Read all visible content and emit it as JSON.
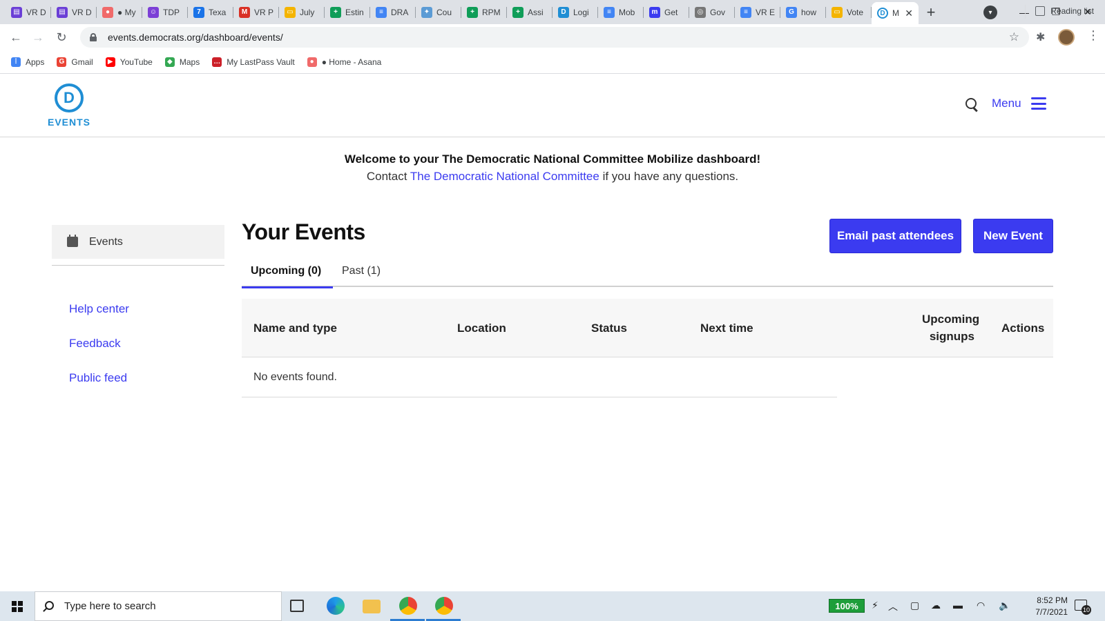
{
  "browser": {
    "tabs": [
      {
        "title": "VR D",
        "icon": "form-icon",
        "color": "#6b3fd6"
      },
      {
        "title": "VR D",
        "icon": "form-icon",
        "color": "#6b3fd6"
      },
      {
        "title": "● My",
        "icon": "asana-icon",
        "color": "#f06a6a"
      },
      {
        "title": "TDP",
        "icon": "people-icon",
        "color": "#7c3fd6"
      },
      {
        "title": "Texa",
        "icon": "calendar-icon",
        "color": "#1a73e8"
      },
      {
        "title": "VR P",
        "icon": "gmail-icon",
        "color": "#d93025"
      },
      {
        "title": "July",
        "icon": "slides-icon",
        "color": "#f4b400"
      },
      {
        "title": "Estin",
        "icon": "sheets-icon",
        "color": "#0f9d58"
      },
      {
        "title": "DRA",
        "icon": "docs-icon",
        "color": "#4285f4"
      },
      {
        "title": "Cou",
        "icon": "star-icon",
        "color": "#5b9bd5"
      },
      {
        "title": "RPM",
        "icon": "sheets-icon",
        "color": "#0f9d58"
      },
      {
        "title": "Assi",
        "icon": "sheets-icon",
        "color": "#0f9d58"
      },
      {
        "title": "Logi",
        "icon": "d-icon",
        "color": "#1f8ed4"
      },
      {
        "title": "Mob",
        "icon": "docs-icon",
        "color": "#4285f4"
      },
      {
        "title": "Get",
        "icon": "m-icon",
        "color": "#3b3bf0"
      },
      {
        "title": "Gov",
        "icon": "seal-icon",
        "color": "#777777"
      },
      {
        "title": "VR E",
        "icon": "docs-icon",
        "color": "#4285f4"
      },
      {
        "title": "how",
        "icon": "google-icon",
        "color": "#4285f4"
      },
      {
        "title": "Vote",
        "icon": "slides-icon",
        "color": "#f4b400"
      }
    ],
    "active_tab": {
      "title": "M",
      "icon": "d-icon",
      "color": "#1f8ed4"
    },
    "url": "events.democrats.org/dashboard/events/",
    "bookmarks": [
      {
        "label": "Apps",
        "icon": "apps-icon",
        "color": "#4285f4"
      },
      {
        "label": "Gmail",
        "icon": "google-icon",
        "color": "#ea4335"
      },
      {
        "label": "YouTube",
        "icon": "youtube-icon",
        "color": "#ff0000"
      },
      {
        "label": "Maps",
        "icon": "maps-icon",
        "color": "#34a853"
      },
      {
        "label": "My LastPass Vault",
        "icon": "lastpass-icon",
        "color": "#cc2029"
      },
      {
        "label": "● Home - Asana",
        "icon": "asana-icon",
        "color": "#f06a6a"
      }
    ],
    "reading_list": "Reading list"
  },
  "site": {
    "logo_letter": "D",
    "logo_text": "EVENTS",
    "menu_label": "Menu",
    "brand_color": "#1f8ed4",
    "accent_color": "#3b3bf0"
  },
  "welcome": {
    "line1": "Welcome to your The Democratic National Committee Mobilize dashboard!",
    "contact_prefix": "Contact ",
    "contact_link": "The Democratic National Committee",
    "contact_suffix": " if you have any questions."
  },
  "sidebar": {
    "events_label": "Events",
    "links": [
      "Help center",
      "Feedback",
      "Public feed"
    ]
  },
  "main": {
    "title": "Your Events",
    "email_button": "Email past attendees",
    "new_button": "New Event",
    "tabs": [
      "Upcoming (0)",
      "Past (1)"
    ],
    "columns": [
      "Name and type",
      "Location",
      "Status",
      "Next time",
      "Upcoming",
      "signups",
      "Actions"
    ],
    "empty_message": "No events found."
  },
  "taskbar": {
    "search_placeholder": "Type here to search",
    "battery": "100%",
    "time": "8:52 PM",
    "date": "7/7/2021",
    "notifications": "10"
  }
}
